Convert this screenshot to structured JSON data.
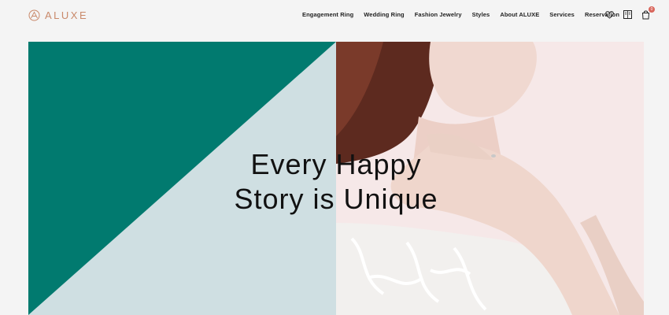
{
  "brand": {
    "name": "ALUXE",
    "accent": "#c9896a"
  },
  "nav": {
    "items": [
      {
        "label": "Engagement Ring"
      },
      {
        "label": "Wedding Ring"
      },
      {
        "label": "Fashion Jewelry"
      },
      {
        "label": "Styles"
      },
      {
        "label": "About ALUXE"
      },
      {
        "label": "Services"
      },
      {
        "label": "Reservation"
      }
    ]
  },
  "header_icons": {
    "wishlist": "heart-icon",
    "catalog": "book-icon",
    "cart": "shopping-bag-icon",
    "cart_count": "0"
  },
  "hero": {
    "headline_line1": "Every Happy",
    "headline_line2": "Story is Unique",
    "colors": {
      "teal": "#017a6f",
      "pale_blue": "#cfdfe2",
      "blush": "#f4e6e6"
    }
  }
}
